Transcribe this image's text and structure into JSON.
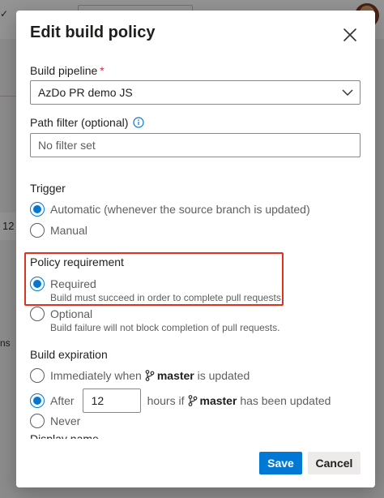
{
  "background": {
    "row_number": "12",
    "side_text": "ns"
  },
  "dialog": {
    "title": "Edit build policy",
    "build_pipeline": {
      "label": "Build pipeline",
      "required_mark": "*",
      "value": "AzDo PR demo JS"
    },
    "path_filter": {
      "label": "Path filter (optional)",
      "placeholder": "No filter set"
    },
    "trigger": {
      "label": "Trigger",
      "options": [
        {
          "label": "Automatic (whenever the source branch is updated)",
          "checked": true
        },
        {
          "label": "Manual",
          "checked": false
        }
      ]
    },
    "policy_requirement": {
      "label": "Policy requirement",
      "options": [
        {
          "label": "Required",
          "description": "Build must succeed in order to complete pull requests.",
          "checked": true
        },
        {
          "label": "Optional",
          "description": "Build failure will not block completion of pull requests.",
          "checked": false
        }
      ]
    },
    "build_expiration": {
      "label": "Build expiration",
      "immediately_prefix": "Immediately when",
      "branch": "master",
      "immediately_suffix": "is updated",
      "after_label": "After",
      "hours_value": "12",
      "hours_prefix": "hours if",
      "hours_suffix": "has been updated",
      "never_label": "Never"
    },
    "display_name": {
      "label": "Display name"
    },
    "footer": {
      "save_label": "Save",
      "cancel_label": "Cancel"
    }
  },
  "colors": {
    "accent": "#0078d4",
    "required": "#c4314b",
    "highlight": "#e0301e"
  }
}
